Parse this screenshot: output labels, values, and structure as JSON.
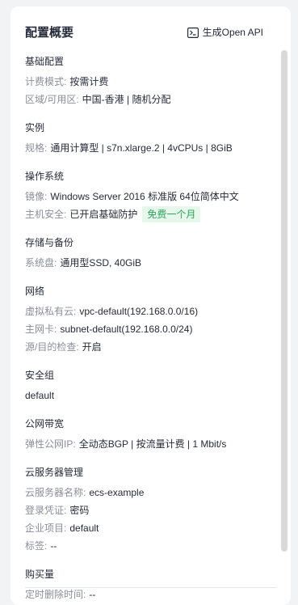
{
  "panel": {
    "title": "配置概要",
    "openapi_label": "生成Open API"
  },
  "sections": {
    "basic": {
      "title": "基础配置",
      "billing_label": "计费模式:",
      "billing_value": "按需计费",
      "region_label": "区域/可用区:",
      "region_value": "中国-香港 | 随机分配"
    },
    "instance": {
      "title": "实例",
      "spec_label": "规格:",
      "spec_value": "通用计算型 | s7n.xlarge.2 | 4vCPUs | 8GiB"
    },
    "os": {
      "title": "操作系统",
      "image_label": "镜像:",
      "image_value": "Windows Server 2016 标准版 64位简体中文",
      "security_label": "主机安全:",
      "security_value": "已开启基础防护",
      "security_badge": "免费一个月"
    },
    "storage": {
      "title": "存储与备份",
      "disk_label": "系统盘:",
      "disk_value": "通用型SSD, 40GiB"
    },
    "network": {
      "title": "网络",
      "vpc_label": "虚拟私有云:",
      "vpc_value": "vpc-default(192.168.0.0/16)",
      "nic_label": "主网卡:",
      "nic_value": "subnet-default(192.168.0.0/24)",
      "check_label": "源/目的检查:",
      "check_value": "开启"
    },
    "security_group": {
      "title": "安全组",
      "value": "default"
    },
    "bandwidth": {
      "title": "公网带宽",
      "eip_label": "弹性公网IP:",
      "eip_value": "全动态BGP | 按流量计费 | 1 Mbit/s"
    },
    "management": {
      "title": "云服务器管理",
      "name_label": "云服务器名称:",
      "name_value": "ecs-example",
      "credential_label": "登录凭证:",
      "credential_value": "密码",
      "project_label": "企业项目:",
      "project_value": "default",
      "tag_label": "标签:",
      "tag_value": "--"
    },
    "purchase": {
      "title": "购买量",
      "delete_label": "定时删除时间:",
      "delete_value": "--"
    }
  }
}
